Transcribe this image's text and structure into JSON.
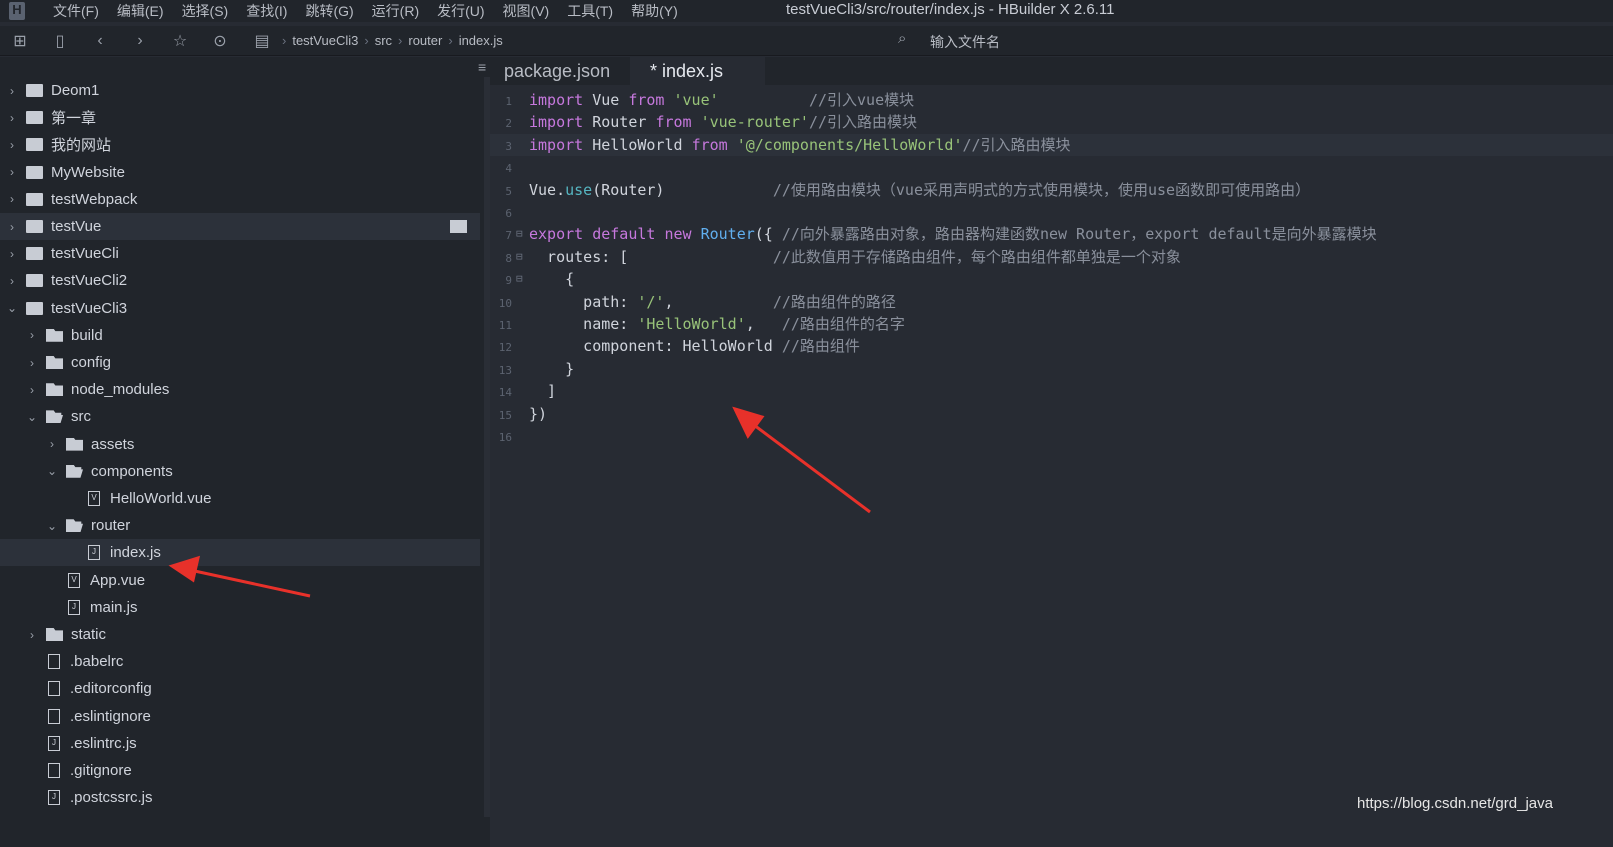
{
  "window": {
    "title": "testVueCli3/src/router/index.js - HBuilder X 2.6.11",
    "logo": "H"
  },
  "menu": [
    "文件(F)",
    "编辑(E)",
    "选择(S)",
    "查找(I)",
    "跳转(G)",
    "运行(R)",
    "发行(U)",
    "视图(V)",
    "工具(T)",
    "帮助(Y)"
  ],
  "toolbar": {
    "icons": [
      "new-file-icon",
      "save-icon",
      "back-icon",
      "forward-icon",
      "star-icon",
      "run-icon"
    ],
    "breadcrumb": [
      "testVueCli3",
      "src",
      "router",
      "index.js"
    ],
    "file_search_placeholder": "输入文件名"
  },
  "tree": [
    {
      "label": "Deom1",
      "depth": 0,
      "type": "proj",
      "chev": "›"
    },
    {
      "label": "第一章",
      "depth": 0,
      "type": "proj",
      "chev": "›"
    },
    {
      "label": "我的网站",
      "depth": 0,
      "type": "proj",
      "chev": "›"
    },
    {
      "label": "MyWebsite",
      "depth": 0,
      "type": "proj",
      "chev": "›"
    },
    {
      "label": "testWebpack",
      "depth": 0,
      "type": "proj",
      "chev": "›"
    },
    {
      "label": "testVue",
      "depth": 0,
      "type": "proj",
      "chev": "›",
      "hover": true
    },
    {
      "label": "testVueCli",
      "depth": 0,
      "type": "proj",
      "chev": "›"
    },
    {
      "label": "testVueCli2",
      "depth": 0,
      "type": "proj",
      "chev": "›"
    },
    {
      "label": "testVueCli3",
      "depth": 0,
      "type": "proj",
      "chev": "⌄"
    },
    {
      "label": "build",
      "depth": 1,
      "type": "dir",
      "chev": "›"
    },
    {
      "label": "config",
      "depth": 1,
      "type": "dir",
      "chev": "›"
    },
    {
      "label": "node_modules",
      "depth": 1,
      "type": "dir",
      "chev": "›"
    },
    {
      "label": "src",
      "depth": 1,
      "type": "open",
      "chev": "⌄"
    },
    {
      "label": "assets",
      "depth": 2,
      "type": "dir",
      "chev": "›"
    },
    {
      "label": "components",
      "depth": 2,
      "type": "open",
      "chev": "⌄"
    },
    {
      "label": "HelloWorld.vue",
      "depth": 3,
      "type": "file",
      "mark": "V"
    },
    {
      "label": "router",
      "depth": 2,
      "type": "open",
      "chev": "⌄"
    },
    {
      "label": "index.js",
      "depth": 3,
      "type": "file",
      "mark": "J",
      "selected": true
    },
    {
      "label": "App.vue",
      "depth": 2,
      "type": "file",
      "mark": "V"
    },
    {
      "label": "main.js",
      "depth": 2,
      "type": "file",
      "mark": "J"
    },
    {
      "label": "static",
      "depth": 1,
      "type": "dir",
      "chev": "›"
    },
    {
      "label": ".babelrc",
      "depth": 1,
      "type": "file",
      "mark": ""
    },
    {
      "label": ".editorconfig",
      "depth": 1,
      "type": "file",
      "mark": ""
    },
    {
      "label": ".eslintignore",
      "depth": 1,
      "type": "file",
      "mark": ""
    },
    {
      "label": ".eslintrc.js",
      "depth": 1,
      "type": "file",
      "mark": "J"
    },
    {
      "label": ".gitignore",
      "depth": 1,
      "type": "file",
      "mark": ""
    },
    {
      "label": ".postcssrc.js",
      "depth": 1,
      "type": "file",
      "mark": "J"
    }
  ],
  "tabs": [
    {
      "label": "package.json"
    },
    {
      "label": "* index.js",
      "active": true
    }
  ],
  "code": [
    [
      [
        "kw",
        "import"
      ],
      [
        "pl",
        " Vue "
      ],
      [
        "kw",
        "from"
      ],
      [
        "pl",
        " "
      ],
      [
        "str",
        "'vue'"
      ],
      [
        "pl",
        "          "
      ],
      [
        "cm",
        "//引入vue模块"
      ]
    ],
    [
      [
        "kw",
        "import"
      ],
      [
        "pl",
        " Router "
      ],
      [
        "kw",
        "from"
      ],
      [
        "pl",
        " "
      ],
      [
        "str",
        "'vue-router'"
      ],
      [
        "cm",
        "//引入路由模块"
      ]
    ],
    [
      [
        "kw",
        "import"
      ],
      [
        "pl",
        " HelloWorld "
      ],
      [
        "kw",
        "from"
      ],
      [
        "pl",
        " "
      ],
      [
        "str",
        "'@/components/HelloWorld'"
      ],
      [
        "cm",
        "//引入路由模块"
      ]
    ],
    [],
    [
      [
        "pl",
        "Vue."
      ],
      [
        "fn",
        "use"
      ],
      [
        "pl",
        "(Router)            "
      ],
      [
        "cm",
        "//使用路由模块（vue采用声明式的方式使用模块，使用use函数即可使用路由）"
      ]
    ],
    [],
    [
      [
        "kw",
        "export"
      ],
      [
        "pl",
        " "
      ],
      [
        "kw",
        "default"
      ],
      [
        "pl",
        " "
      ],
      [
        "kw",
        "new"
      ],
      [
        "pl",
        " "
      ],
      [
        "cls",
        "Router"
      ],
      [
        "pl",
        "({ "
      ],
      [
        "cm",
        "//向外暴露路由对象，路由器构建函数new Router，export default是向外暴露模块"
      ]
    ],
    [
      [
        "pl",
        "  routes: [                "
      ],
      [
        "cm",
        "//此数值用于存储路由组件，每个路由组件都单独是一个对象"
      ]
    ],
    [
      [
        "pl",
        "    {"
      ]
    ],
    [
      [
        "pl",
        "      path: "
      ],
      [
        "str",
        "'/'"
      ],
      [
        "pl",
        ",           "
      ],
      [
        "cm",
        "//路由组件的路径"
      ]
    ],
    [
      [
        "pl",
        "      name: "
      ],
      [
        "str",
        "'HelloWorld'"
      ],
      [
        "pl",
        ",   "
      ],
      [
        "cm",
        "//路由组件的名字"
      ]
    ],
    [
      [
        "pl",
        "      component: HelloWorld "
      ],
      [
        "cm",
        "//路由组件"
      ]
    ],
    [
      [
        "pl",
        "    }"
      ]
    ],
    [
      [
        "pl",
        "  ]"
      ]
    ],
    [
      [
        "pl",
        "})"
      ]
    ],
    []
  ],
  "watermark": "https://blog.csdn.net/grd_java",
  "colors": {
    "keyword": "#c678dd",
    "string": "#98c379",
    "comment": "#8a909c",
    "annotation_arrow": "#e8312a"
  }
}
